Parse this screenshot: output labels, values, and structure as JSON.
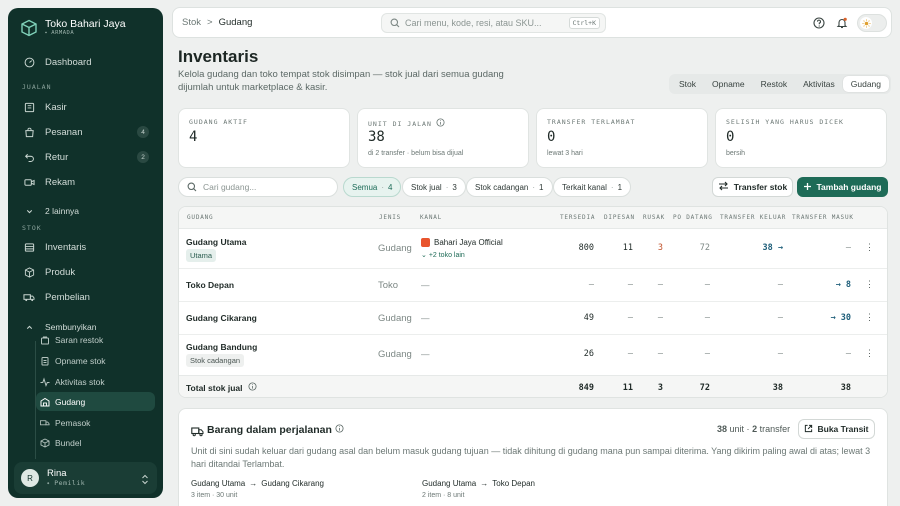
{
  "brand": {
    "name": "Toko Bahari Jaya",
    "sub": "ARMADA"
  },
  "sidebar": {
    "dashboard": "Dashboard",
    "section_jualan": "JUALAN",
    "kasir": "Kasir",
    "pesanan": "Pesanan",
    "pesanan_badge": "4",
    "retur": "Retur",
    "retur_badge": "2",
    "rekam": "Rekam",
    "more": "2 lainnya",
    "section_stok": "STOK",
    "inventaris": "Inventaris",
    "produk": "Produk",
    "pembelian": "Pembelian",
    "sembunyikan": "Sembunyikan",
    "sub_items": [
      "Saran restok",
      "Opname stok",
      "Aktivitas stok",
      "Gudang",
      "Pemasok",
      "Bundel"
    ]
  },
  "user": {
    "initial": "R",
    "name": "Rina",
    "role": "Pemilik"
  },
  "topbar": {
    "crumb_parent": "Stok",
    "crumb_sep": ">",
    "crumb_current": "Gudang",
    "search_placeholder": "Cari menu, kode, resi, atau SKU...",
    "shortcut": "Ctrl+K"
  },
  "page": {
    "title": "Inventaris",
    "subtitle": "Kelola gudang dan toko tempat stok disimpan — stok jual dari semua gudang dijumlah untuk marketplace & kasir.",
    "tabs": [
      "Stok",
      "Opname",
      "Restok",
      "Aktivitas",
      "Gudang"
    ],
    "active_tab": "Gudang"
  },
  "stats": [
    {
      "label": "GUDANG AKTIF",
      "value": "4",
      "note": ""
    },
    {
      "label": "UNIT DI JALAN",
      "value": "38",
      "note": "di 2 transfer · belum bisa dijual"
    },
    {
      "label": "TRANSFER TERLAMBAT",
      "value": "0",
      "note": "lewat 3 hari"
    },
    {
      "label": "SELISIH YANG HARUS DICEK",
      "value": "0",
      "note": "bersih"
    }
  ],
  "filters": {
    "search_placeholder": "Cari gudang...",
    "chips": [
      {
        "label": "Semua",
        "count": "4"
      },
      {
        "label": "Stok jual",
        "count": "3"
      },
      {
        "label": "Stok cadangan",
        "count": "1"
      },
      {
        "label": "Terkait kanal",
        "count": "1"
      }
    ],
    "transfer_btn": "Transfer stok",
    "add_btn": "Tambah gudang"
  },
  "table": {
    "headers": [
      "GUDANG",
      "JENIS",
      "KANAL",
      "TERSEDIA",
      "DIPESAN",
      "RUSAK",
      "PO DATANG",
      "TRANSFER KELUAR",
      "TRANSFER MASUK"
    ],
    "rows": [
      {
        "name": "Gudang Utama",
        "tag": "Utama",
        "jenis": "Gudang",
        "kanal": "Bahari Jaya Official",
        "kanal_more": "+2 toko lain",
        "tersedia": "800",
        "dipesan": "11",
        "rusak": "3",
        "po": "72",
        "keluar": "38 →",
        "masuk": "—"
      },
      {
        "name": "Toko Depan",
        "tag": "",
        "jenis": "Toko",
        "kanal": "—",
        "kanal_more": "",
        "tersedia": "—",
        "dipesan": "—",
        "rusak": "—",
        "po": "—",
        "keluar": "—",
        "masuk": "→ 8"
      },
      {
        "name": "Gudang Cikarang",
        "tag": "",
        "jenis": "Gudang",
        "kanal": "—",
        "kanal_more": "",
        "tersedia": "49",
        "dipesan": "—",
        "rusak": "—",
        "po": "—",
        "keluar": "—",
        "masuk": "→ 30"
      },
      {
        "name": "Gudang Bandung",
        "tag": "Stok cadangan",
        "jenis": "Gudang",
        "kanal": "—",
        "kanal_more": "",
        "tersedia": "26",
        "dipesan": "—",
        "rusak": "—",
        "po": "—",
        "keluar": "—",
        "masuk": "—"
      }
    ],
    "total": {
      "label": "Total stok jual",
      "tersedia": "849",
      "dipesan": "11",
      "rusak": "3",
      "po": "72",
      "keluar": "38",
      "masuk": "38"
    }
  },
  "transit": {
    "title": "Barang dalam perjalanan",
    "summary_units": "38",
    "summary_units_label": "unit ·",
    "summary_transfers": "2",
    "summary_transfers_label": "transfer",
    "open_btn": "Buka Transit",
    "desc": "Unit di sini sudah keluar dari gudang asal dan belum masuk gudang tujuan — tidak dihitung di gudang mana pun sampai diterima. Yang dikirim paling awal di atas; lewat 3 hari ditandai Terlambat.",
    "routes": [
      {
        "from": "Gudang Utama",
        "to": "Gudang Cikarang",
        "detail": "3 item · 30 unit"
      },
      {
        "from": "Gudang Utama",
        "to": "Toko Depan",
        "detail": "2 item · 8 unit"
      }
    ]
  },
  "colors": {
    "sidebar": "#10312a",
    "accent": "#1e6b57",
    "link": "#1f5f7a",
    "warn": "#c0512a"
  }
}
